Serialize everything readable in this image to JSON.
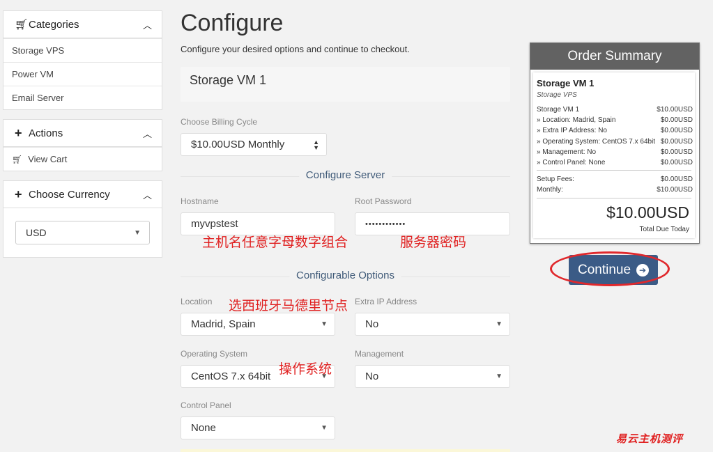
{
  "sidebar": {
    "categories": {
      "title": "Categories",
      "items": [
        "Storage VPS",
        "Power VM",
        "Email Server"
      ]
    },
    "actions": {
      "title": "Actions",
      "items": [
        "View Cart"
      ]
    },
    "currency": {
      "title": "Choose Currency",
      "selected": "USD"
    }
  },
  "main": {
    "title": "Configure",
    "subtitle": "Configure your desired options and continue to checkout.",
    "product_name": "Storage VM 1",
    "billing_cycle": {
      "label": "Choose Billing Cycle",
      "value": "$10.00USD Monthly"
    },
    "configure_server": {
      "heading": "Configure Server",
      "hostname_label": "Hostname",
      "hostname_value": "myvpstest",
      "password_label": "Root Password",
      "password_value": "••••••••••••"
    },
    "configurable_options": {
      "heading": "Configurable Options",
      "location": {
        "label": "Location",
        "value": "Madrid, Spain"
      },
      "extra_ip": {
        "label": "Extra IP Address",
        "value": "No"
      },
      "os": {
        "label": "Operating System",
        "value": "CentOS 7.x 64bit"
      },
      "management": {
        "label": "Management",
        "value": "No"
      },
      "control_panel": {
        "label": "Control Panel",
        "value": "None"
      }
    }
  },
  "annotations": {
    "hostname": "主机名任意字母数字组合",
    "password": "服务器密码",
    "location": "选西班牙马德里节点",
    "os": "操作系统"
  },
  "summary": {
    "title": "Order Summary",
    "product": "Storage VM 1",
    "group": "Storage VPS",
    "lines": [
      {
        "desc": "Storage VM 1",
        "amount": "$10.00USD"
      },
      {
        "desc": "» Location: Madrid, Spain",
        "amount": "$0.00USD"
      },
      {
        "desc": "» Extra IP Address: No",
        "amount": "$0.00USD"
      },
      {
        "desc": "» Operating System: CentOS 7.x 64bit",
        "amount": "$0.00USD"
      },
      {
        "desc": "» Management: No",
        "amount": "$0.00USD"
      },
      {
        "desc": "» Control Panel: None",
        "amount": "$0.00USD"
      }
    ],
    "fees": [
      {
        "desc": "Setup Fees:",
        "amount": "$0.00USD"
      },
      {
        "desc": "Monthly:",
        "amount": "$10.00USD"
      }
    ],
    "total": "$10.00USD",
    "total_label": "Total Due Today"
  },
  "continue_label": "Continue",
  "watermark": "易云主机测评",
  "colors": {
    "accent": "#3b5b86",
    "section_heading": "#3f5a78",
    "annotation": "#e02020",
    "summary_header": "#626262"
  }
}
